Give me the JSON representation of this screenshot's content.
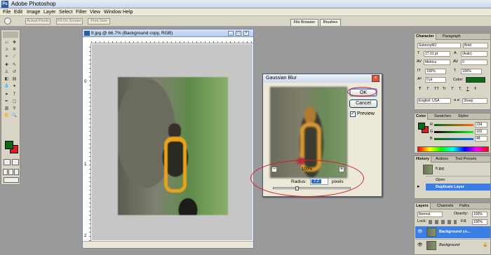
{
  "app": {
    "title": "Adobe Photoshop"
  },
  "menu": [
    "File",
    "Edit",
    "Image",
    "Layer",
    "Select",
    "Filter",
    "View",
    "Window",
    "Help"
  ],
  "options_bar": {
    "buttons": [
      "Actual Pixels",
      "Fit On Screen",
      "Print Size"
    ],
    "tabs": [
      "File Browser",
      "Brushes"
    ]
  },
  "document": {
    "title": "fr.jpg @ 66.7% (Background copy, RGB)",
    "ruler_v_labels": [
      "0",
      "1",
      "2"
    ]
  },
  "dialog": {
    "title": "Gaussian Blur",
    "ok_label": "OK",
    "cancel_label": "Cancel",
    "preview_label": "Preview",
    "preview_checked": true,
    "zoom_minus": "−",
    "zoom_plus": "+",
    "zoom_level": "100%",
    "radius_label": "Radius:",
    "radius_value": "7.2",
    "radius_unit": "pixels",
    "radius_slider_fraction": 0.3
  },
  "character_panel": {
    "tabs": [
      "Character",
      "Paragraph"
    ],
    "font": "SutonnyMJ",
    "style": "Bold",
    "size": "17.01 pt",
    "leading": "(Auto)",
    "kerning": "Metrics",
    "tracking": "0",
    "vscale": "100%",
    "hscale": "100%",
    "baseline": "0 pt",
    "color_label": "Color:",
    "style_buttons": [
      "T",
      "T",
      "TT",
      "Tr",
      "T'",
      "T,",
      "T",
      "Ŧ"
    ],
    "language": "English: USA",
    "aa_label": "a a",
    "antialias": "Sharp"
  },
  "color_panel": {
    "tabs": [
      "Color",
      "Swatches",
      "Styles"
    ],
    "channels": [
      {
        "label": "R",
        "value": "234"
      },
      {
        "label": "G",
        "value": "102"
      },
      {
        "label": "B",
        "value": "48"
      }
    ]
  },
  "history_panel": {
    "tabs": [
      "History",
      "Actions",
      "Tool Presets"
    ],
    "snapshot": "fr.jpg",
    "items": [
      "Open",
      "Duplicate Layer"
    ]
  },
  "layers_panel": {
    "tabs": [
      "Layers",
      "Channels",
      "Paths"
    ],
    "blend_mode": "Normal",
    "opacity_label": "Opacity:",
    "opacity": "100%",
    "lock_label": "Lock:",
    "fill_label": "Fill:",
    "fill": "100%",
    "layers": [
      "Background co...",
      "Background"
    ]
  },
  "colors": {
    "foreground": "#0a6b14",
    "background": "#e01b1b",
    "selection": "#3b7fe6",
    "annotation": "#d31f2a"
  }
}
